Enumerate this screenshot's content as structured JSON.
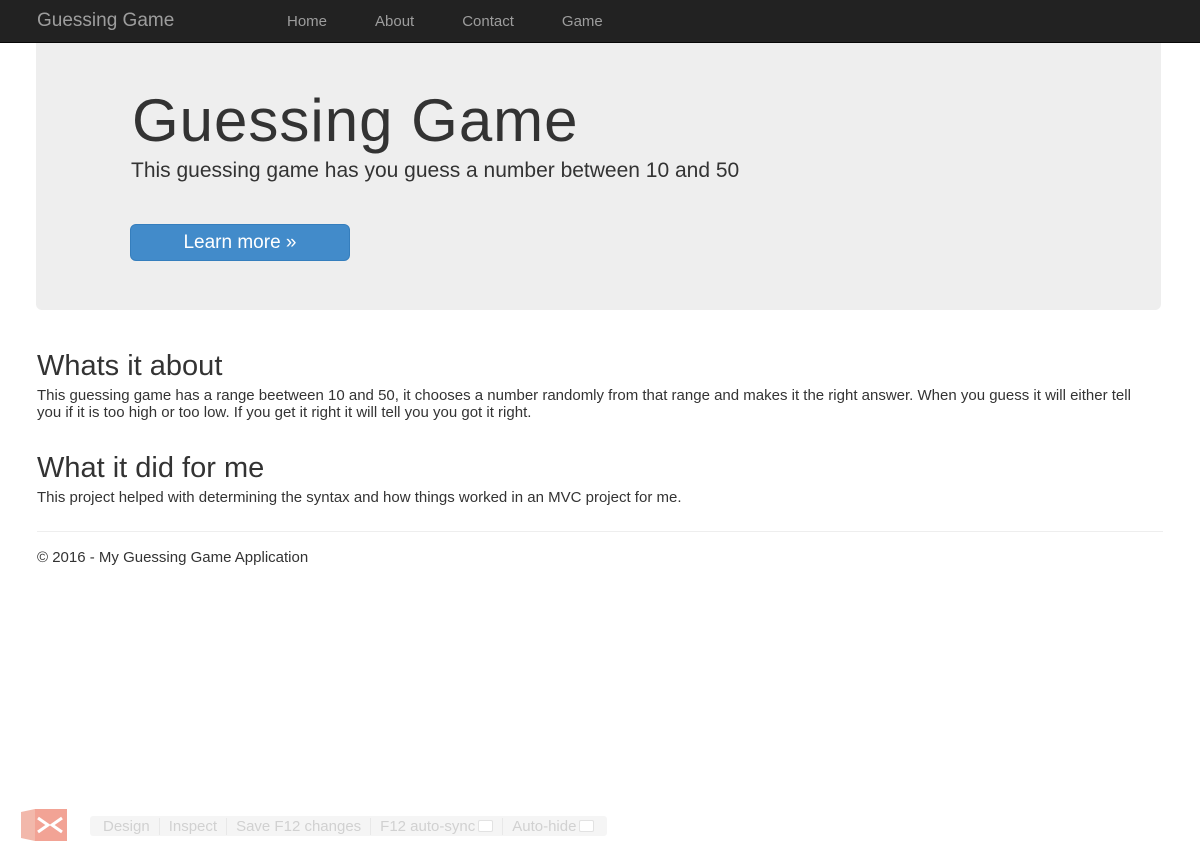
{
  "navbar": {
    "brand": "Guessing Game",
    "links": [
      "Home",
      "About",
      "Contact",
      "Game"
    ]
  },
  "jumbotron": {
    "title": "Guessing Game",
    "lead": "This guessing game has you guess a number between 10 and 50",
    "button_label": "Learn more »"
  },
  "sections": [
    {
      "title": "Whats it about",
      "body": "This guessing game has a range beetween 10 and 50, it chooses a number randomly from that range and makes it the right answer. When you guess it will either tell you if it is too high or too low. If you get it right it will tell you you got it right."
    },
    {
      "title": "What it did for me",
      "body": "This project helped with determining the syntax and how things worked in an MVC project for me."
    }
  ],
  "footer": {
    "text": "© 2016 - My Guessing Game Application"
  },
  "browser_link_toolbar": {
    "icon": "visual-studio-logo-icon",
    "design": "Design",
    "inspect": "Inspect",
    "save": "Save F12 changes",
    "autosync": "F12 auto-sync",
    "autohide": "Auto-hide"
  },
  "colors": {
    "navbar_bg": "#222222",
    "nav_text": "#9d9d9d",
    "jumbotron_bg": "#eeeeee",
    "primary": "#428bca",
    "vs_logo": "#e8583e"
  }
}
